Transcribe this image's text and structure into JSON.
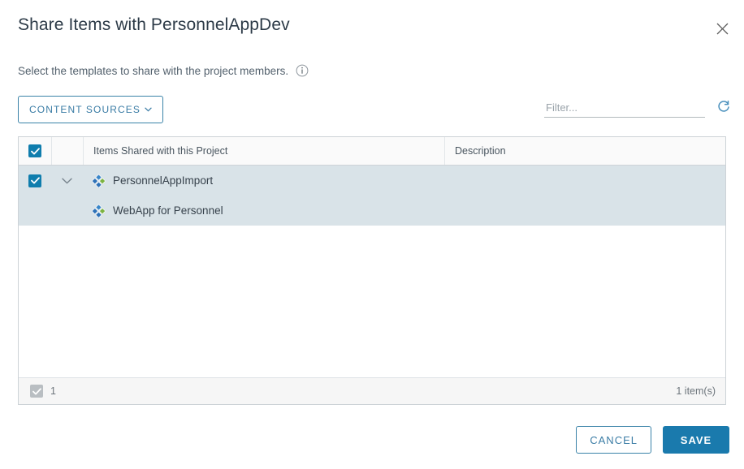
{
  "dialog": {
    "title": "Share Items with PersonnelAppDev",
    "subtitle": "Select the templates to share with the project members.",
    "close_icon": "close-icon",
    "info_icon": "info-icon"
  },
  "toolbar": {
    "content_sources_label": "CONTENT SOURCES",
    "content_sources_chevron": "chevron-down-icon",
    "filter_placeholder": "Filter...",
    "filter_value": "",
    "refresh_icon": "refresh-icon"
  },
  "table": {
    "columns": [
      {
        "key": "check",
        "label": ""
      },
      {
        "key": "expand",
        "label": ""
      },
      {
        "key": "name",
        "label": "Items Shared with this Project"
      },
      {
        "key": "description",
        "label": "Description"
      }
    ],
    "header_checkbox_checked": true,
    "rows": [
      {
        "name": "PersonnelAppImport",
        "description": "",
        "checked": true,
        "selected": true,
        "expandable": true,
        "expanded": true,
        "indent": 0,
        "icon": "template-icon"
      },
      {
        "name": "WebApp for Personnel",
        "description": "",
        "checked": false,
        "selected": true,
        "expandable": false,
        "expanded": false,
        "indent": 1,
        "icon": "template-icon"
      }
    ],
    "footer": {
      "selected_count": "1",
      "footer_checkbox_checked": true,
      "footer_checkbox_disabled": true,
      "item_count_label": "1 item(s)"
    }
  },
  "actions": {
    "cancel_label": "CANCEL",
    "save_label": "SAVE"
  },
  "colors": {
    "accent_blue": "#1a7aad",
    "link_blue": "#3a7ca5",
    "checkbox_blue": "#0f7dad",
    "row_selected": "#d9e3e8",
    "border_gray": "#cdd3d7",
    "text_dark": "#37424c",
    "text_muted": "#6d757c"
  }
}
